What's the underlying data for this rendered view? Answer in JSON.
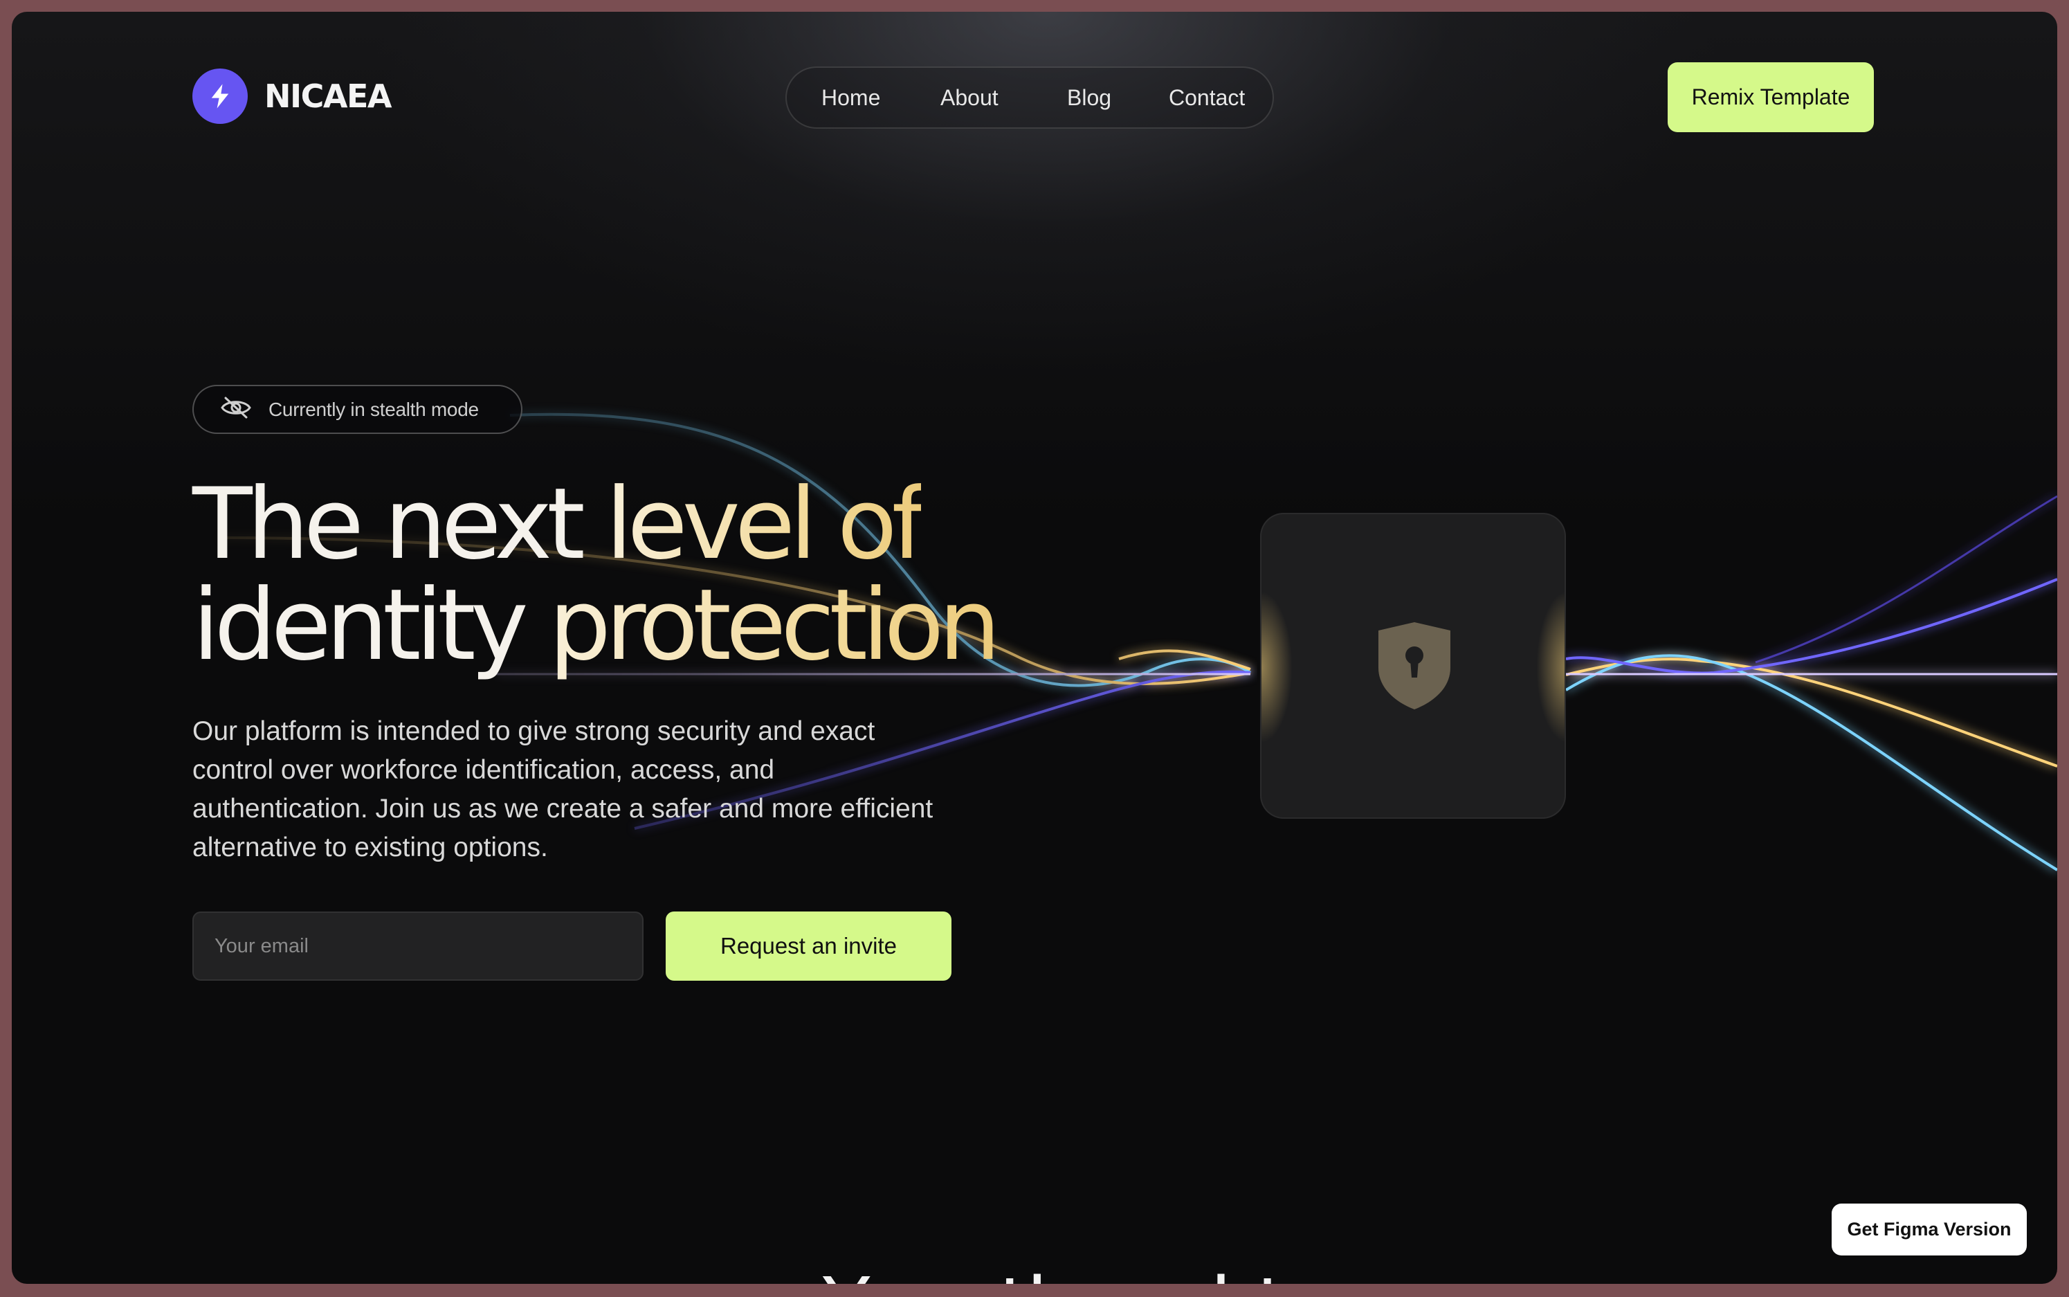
{
  "brand": {
    "name": "NICAEA",
    "icon": "lightning-bolt-icon",
    "accent": "#6655f2"
  },
  "nav": {
    "links": [
      "Home",
      "About",
      "Blog",
      "Contact"
    ]
  },
  "header": {
    "cta_label": "Remix Template",
    "cta_color": "#d5f98a"
  },
  "hero": {
    "badge_icon": "eye-off-icon",
    "badge_text": "Currently in stealth mode",
    "title_line1_plain": "The next ",
    "title_line1_highlight": "level of",
    "title_line2_plain": "identity ",
    "title_line2_highlight": "protection",
    "description": "Our platform is intended to give strong security and exact control over workforce identification, access, and authentication. Join us as we create a safer and more efficient alternative to existing options.",
    "email_placeholder": "Your email",
    "invite_label": "Request an invite"
  },
  "visual": {
    "icon": "shield-keyhole-icon",
    "wave_colors": [
      "#ffd37a",
      "#7dd3fc",
      "#6f66ff",
      "#d8c9ff"
    ]
  },
  "next_section": {
    "heading_partial": "Your thought"
  },
  "figma_button": {
    "label": "Get Figma Version"
  }
}
